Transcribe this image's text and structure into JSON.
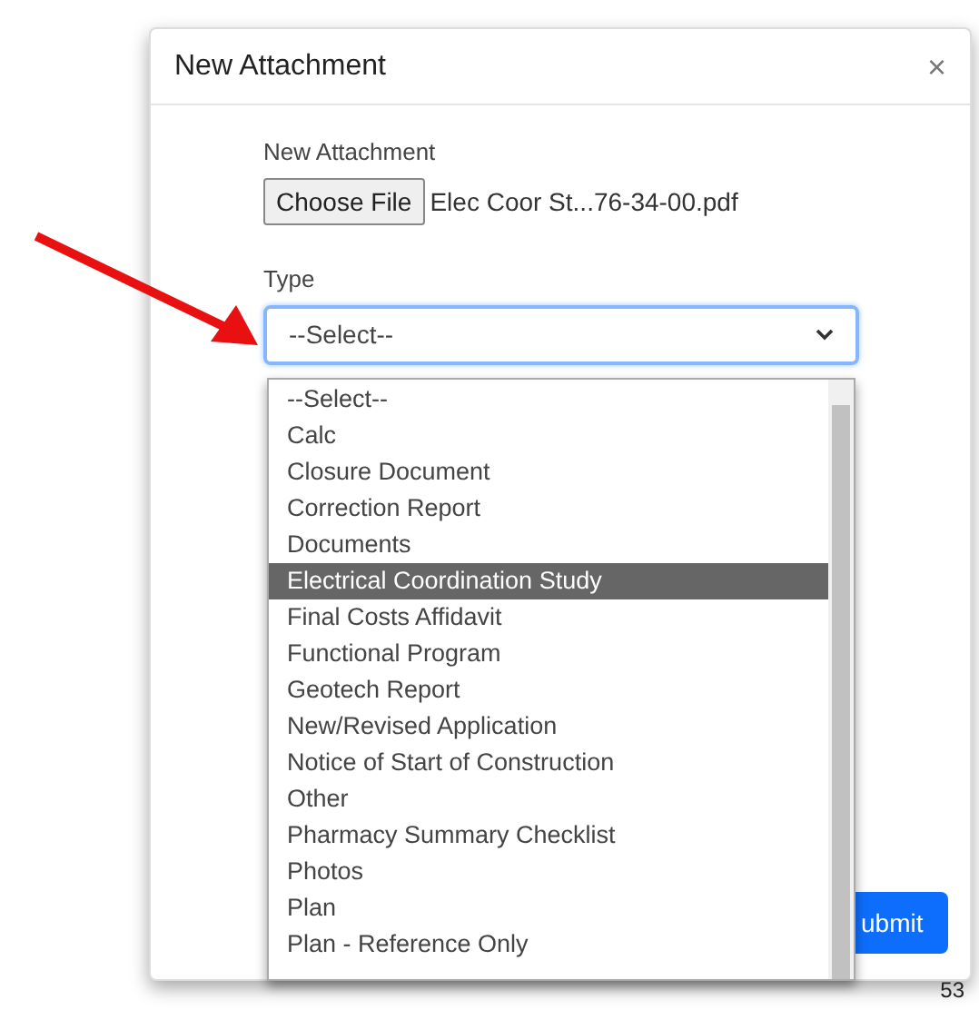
{
  "dialog": {
    "title": "New Attachment",
    "close": "×"
  },
  "file": {
    "label": "New Attachment",
    "button": "Choose File",
    "filename": "Elec Coor St...76-34-00.pdf"
  },
  "type": {
    "label": "Type",
    "value": "--Select--",
    "options": [
      {
        "label": "--Select--",
        "highlighted": false
      },
      {
        "label": "Calc",
        "highlighted": false
      },
      {
        "label": "Closure Document",
        "highlighted": false
      },
      {
        "label": "Correction Report",
        "highlighted": false
      },
      {
        "label": "Documents",
        "highlighted": false
      },
      {
        "label": "Electrical Coordination Study",
        "highlighted": true
      },
      {
        "label": "Final Costs Affidavit",
        "highlighted": false
      },
      {
        "label": "Functional Program",
        "highlighted": false
      },
      {
        "label": "Geotech Report",
        "highlighted": false
      },
      {
        "label": "New/Revised Application",
        "highlighted": false
      },
      {
        "label": "Notice of Start of Construction",
        "highlighted": false
      },
      {
        "label": "Other",
        "highlighted": false
      },
      {
        "label": "Pharmacy Summary Checklist",
        "highlighted": false
      },
      {
        "label": "Photos",
        "highlighted": false
      },
      {
        "label": "Plan",
        "highlighted": false
      },
      {
        "label": "Plan - Reference Only",
        "highlighted": false
      }
    ]
  },
  "submit": "ubmit",
  "page_number": "53"
}
